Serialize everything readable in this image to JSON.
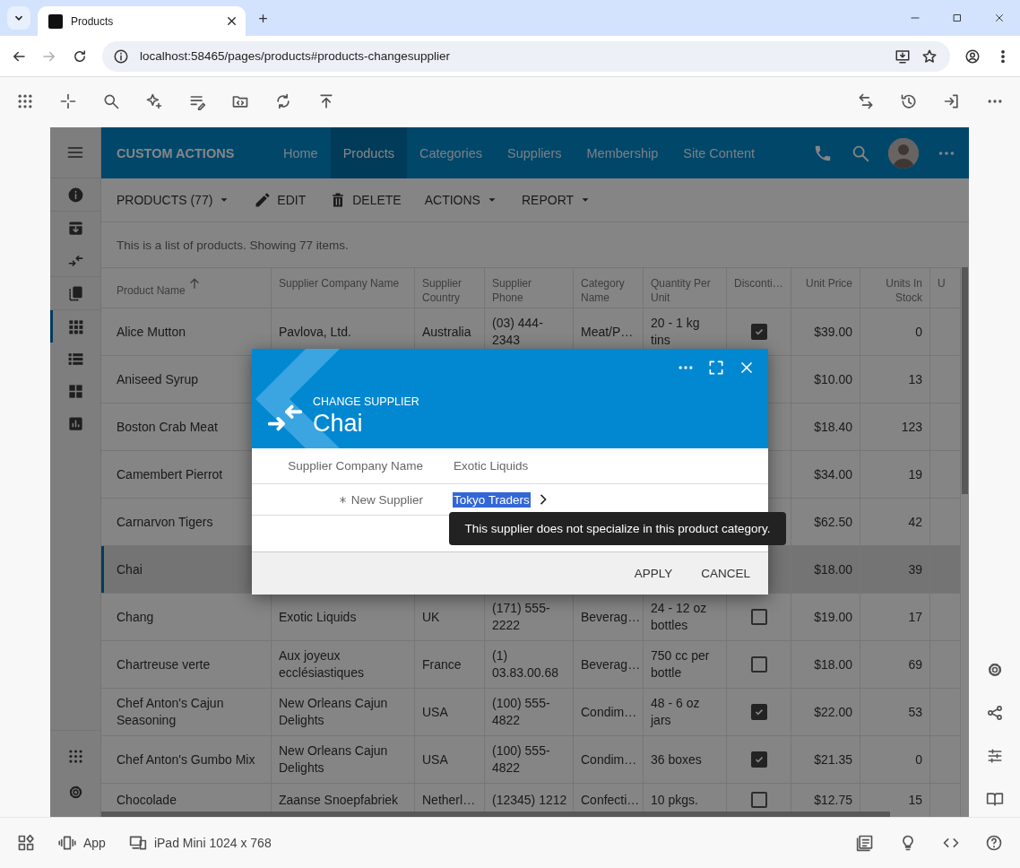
{
  "browser": {
    "tab": {
      "title": "Products"
    },
    "url": "localhost:58465/pages/products#products-changesupplier",
    "forward_disabled": true
  },
  "app": {
    "brand": "CUSTOM ACTIONS",
    "nav": [
      {
        "label": "Home",
        "selected": false
      },
      {
        "label": "Products",
        "selected": true
      },
      {
        "label": "Categories",
        "selected": false
      },
      {
        "label": "Suppliers",
        "selected": false
      },
      {
        "label": "Membership",
        "selected": false
      },
      {
        "label": "Site Content",
        "selected": false
      }
    ],
    "rail": [
      {
        "selected": false
      },
      {
        "selected": false
      },
      {
        "selected": false
      },
      {
        "selected": false
      },
      {
        "selected": true
      },
      {
        "selected": false
      },
      {
        "selected": false
      },
      {
        "selected": false
      }
    ],
    "actions": [
      {
        "label": "PRODUCTS (77)",
        "kind": "menu"
      },
      {
        "label": "EDIT",
        "kind": "edit"
      },
      {
        "label": "DELETE",
        "kind": "delete"
      },
      {
        "label": "ACTIONS",
        "kind": "menu"
      },
      {
        "label": "REPORT",
        "kind": "menu"
      }
    ],
    "description": "This is a list of products. Showing 77 items.",
    "table": {
      "columns": [
        {
          "label": "Product Name",
          "sorted_ascending": true
        },
        {
          "label": "Supplier Company Name"
        },
        {
          "label": "Supplier Country"
        },
        {
          "label": "Supplier Phone"
        },
        {
          "label": "Category Name"
        },
        {
          "label": "Quantity Per Unit"
        },
        {
          "label": "Disconti…"
        },
        {
          "label": "Unit Price"
        },
        {
          "label": "Units In Stock"
        },
        {
          "label": "U"
        }
      ],
      "rows": [
        {
          "product_name": "Alice Mutton",
          "supplier_company_name": "Pavlova, Ltd.",
          "supplier_country": "Australia",
          "supplier_phone": "(03) 444-2343",
          "category_name": "Meat/P…",
          "quantity_per_unit": "20 - 1 kg tins",
          "discontinued": true,
          "unit_price": "$39.00",
          "units_in_stock": "0",
          "selected": false
        },
        {
          "product_name": "Aniseed Syrup",
          "unit_price": "$10.00",
          "units_in_stock": "13",
          "selected": false
        },
        {
          "product_name": "Boston Crab Meat",
          "unit_price": "$18.40",
          "units_in_stock": "123",
          "selected": false
        },
        {
          "product_name": "Camembert Pierrot",
          "unit_price": "$34.00",
          "units_in_stock": "19",
          "selected": false
        },
        {
          "product_name": "Carnarvon Tigers",
          "unit_price": "$62.50",
          "units_in_stock": "42",
          "selected": false
        },
        {
          "product_name": "Chai",
          "unit_price": "$18.00",
          "units_in_stock": "39",
          "selected": true
        },
        {
          "product_name": "Chang",
          "supplier_company_name": "Exotic Liquids",
          "supplier_country": "UK",
          "supplier_phone": "(171) 555-2222",
          "category_name": "Beverag…",
          "quantity_per_unit": "24 - 12 oz bottles",
          "discontinued": false,
          "unit_price": "$19.00",
          "units_in_stock": "17",
          "selected": false
        },
        {
          "product_name": "Chartreuse verte",
          "supplier_company_name": "Aux joyeux ecclésiastiques",
          "supplier_country": "France",
          "supplier_phone": "(1) 03.83.00.68",
          "category_name": "Beverag…",
          "quantity_per_unit": "750 cc per bottle",
          "discontinued": false,
          "unit_price": "$18.00",
          "units_in_stock": "69",
          "selected": false
        },
        {
          "product_name": "Chef Anton's Cajun Seasoning",
          "supplier_company_name": "New Orleans Cajun Delights",
          "supplier_country": "USA",
          "supplier_phone": "(100) 555-4822",
          "category_name": "Condim…",
          "quantity_per_unit": "48 - 6 oz jars",
          "discontinued": true,
          "unit_price": "$22.00",
          "units_in_stock": "53",
          "selected": false
        },
        {
          "product_name": "Chef Anton's Gumbo Mix",
          "supplier_company_name": "New Orleans Cajun Delights",
          "supplier_country": "USA",
          "supplier_phone": "(100) 555-4822",
          "category_name": "Condim…",
          "quantity_per_unit": "36 boxes",
          "discontinued": true,
          "unit_price": "$21.35",
          "units_in_stock": "0",
          "selected": false
        },
        {
          "product_name": "Chocolade",
          "supplier_company_name": "Zaanse Snoepfabriek",
          "supplier_country": "Netherl…",
          "supplier_phone": "(12345) 1212",
          "category_name": "Confecti…",
          "quantity_per_unit": "10 pkgs.",
          "discontinued": false,
          "unit_price": "$12.75",
          "units_in_stock": "15",
          "selected": false
        }
      ]
    }
  },
  "dialog": {
    "action": "CHANGE SUPPLIER",
    "title": "Chai",
    "fields": [
      {
        "label": "Supplier Company Name",
        "value": "Exotic Liquids",
        "required": false,
        "highlighted": false
      },
      {
        "label": "New Supplier",
        "value": "Tokyo Traders",
        "required": true,
        "highlighted": true
      }
    ],
    "tooltip": "This supplier does not specialize in this product category.",
    "buttons": [
      "APPLY",
      "CANCEL"
    ]
  },
  "device_bar": {
    "view": "App",
    "device": "iPad Mini 1024 x 768"
  }
}
